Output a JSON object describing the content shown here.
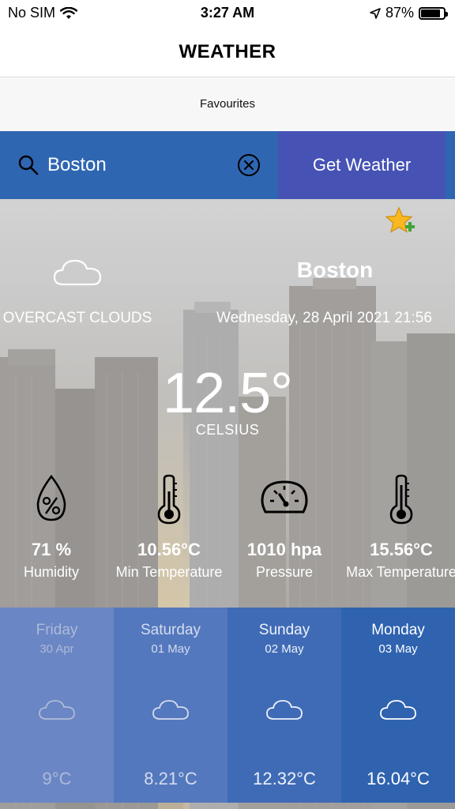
{
  "status_bar": {
    "carrier": "No SIM",
    "time": "3:27 AM",
    "battery": "87%",
    "battery_level": 0.87
  },
  "nav": {
    "title": "WEATHER"
  },
  "favourites": {
    "label": "Favourites"
  },
  "search": {
    "value": "Boston",
    "button_label": "Get Weather"
  },
  "current": {
    "condition": "OVERCAST CLOUDS",
    "city": "Boston",
    "datetime": "Wednesday, 28 April 2021 21:56",
    "temperature": "12.5°",
    "unit": "CELSIUS"
  },
  "stats": [
    {
      "icon": "humidity-drop-icon",
      "value": "71 %",
      "label": "Humidity"
    },
    {
      "icon": "thermometer-icon",
      "value": "10.56°C",
      "label": "Min Temperature"
    },
    {
      "icon": "pressure-gauge-icon",
      "value": "1010 hpa",
      "label": "Pressure"
    },
    {
      "icon": "thermometer-icon",
      "value": "15.56°C",
      "label": "Max Temperature"
    }
  ],
  "forecast": [
    {
      "day": "Friday",
      "date": "30 Apr",
      "temp": "9°C",
      "icon": "cloud-icon"
    },
    {
      "day": "Saturday",
      "date": "01 May",
      "temp": "8.21°C",
      "icon": "cloud-icon"
    },
    {
      "day": "Sunday",
      "date": "02 May",
      "temp": "12.32°C",
      "icon": "cloud-icon"
    },
    {
      "day": "Monday",
      "date": "03 May",
      "temp": "16.04°C",
      "icon": "cloud-icon"
    }
  ],
  "colors": {
    "search_bar": "#2f66b2",
    "button": "#4653b5",
    "forecast_cards": [
      "#6a86c4",
      "#5478bd",
      "#3f6bb6",
      "#2f63b0"
    ],
    "forecast_text": [
      "#aebad9",
      "#d4dcef",
      "#eef2fa",
      "#ffffff"
    ]
  }
}
